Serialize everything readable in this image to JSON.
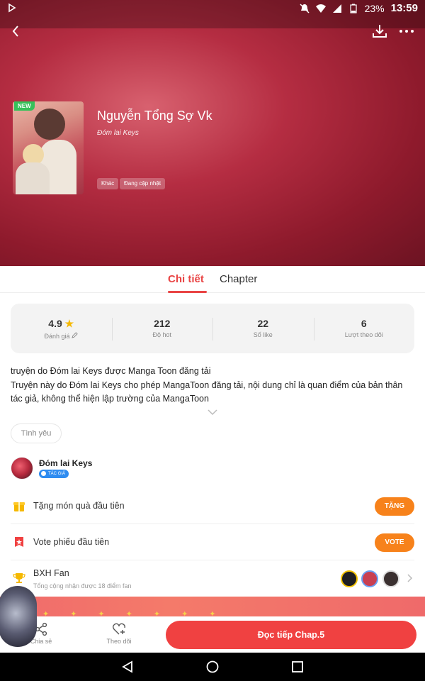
{
  "status_bar": {
    "battery_pct": "23%",
    "time": "13:59"
  },
  "hero": {
    "badge_new": "NEW",
    "title": "Nguyễn Tổng Sợ Vk",
    "author": "Đóm lai Keys",
    "tags": [
      "Khác",
      "Đang cập nhật"
    ]
  },
  "tabs": [
    {
      "label": "Chi tiết",
      "active": true
    },
    {
      "label": "Chapter",
      "active": false
    }
  ],
  "stats": [
    {
      "value": "4.9",
      "label": "Đánh giá"
    },
    {
      "value": "212",
      "label": "Độ hot"
    },
    {
      "value": "22",
      "label": "Số like"
    },
    {
      "value": "6",
      "label": "Lượt theo dõi"
    }
  ],
  "description": {
    "line1": "truyện do Đóm lai Keys được Manga Toon đăng tải",
    "line2": "Truyện này do Đóm lai Keys cho phép MangaToon đăng tải, nội dung chỉ là quan điểm của bản thân tác giả, không thể hiện lập trường của MangaToon"
  },
  "genre": "Tình yêu",
  "author_section": {
    "name": "Đóm lai Keys",
    "badge": "TÁC GIẢ"
  },
  "gift_row": {
    "text": "Tặng món quà đầu tiên",
    "button": "TẶNG"
  },
  "vote_row": {
    "text": "Vote phiếu đầu tiên",
    "button": "VOTE"
  },
  "fan_row": {
    "title": "BXH Fan",
    "subtitle": "Tổng cộng nhận được 18 điểm fan"
  },
  "action_bar": {
    "share_label": "Chia sẻ",
    "follow_label": "Theo dõi",
    "read_label": "Đọc tiếp Chap.5"
  },
  "colors": {
    "accent": "#e94444",
    "orange": "#f7821b",
    "read_button": "#f04141",
    "hero": "#b52d42"
  }
}
